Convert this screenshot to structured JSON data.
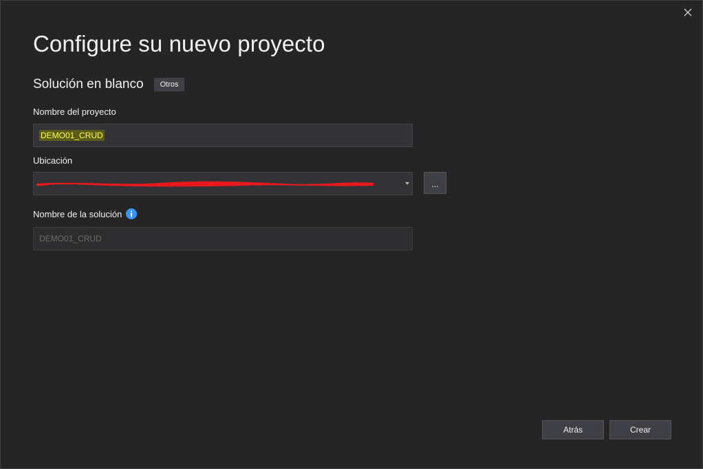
{
  "dialog": {
    "title": "Configure su nuevo proyecto",
    "template_name": "Solución en blanco",
    "template_tag": "Otros"
  },
  "project_name": {
    "label": "Nombre del proyecto",
    "value": "DEMO01_CRUD"
  },
  "location": {
    "label": "Ubicación",
    "value": "",
    "browse_label": "..."
  },
  "solution_name": {
    "label": "Nombre de la solución",
    "placeholder": "DEMO01_CRUD"
  },
  "buttons": {
    "back_label": "Atrás",
    "create_label": "Crear"
  },
  "icons": {
    "close": "close-icon",
    "info": "info-icon",
    "dropdown": "chevron-down-icon"
  },
  "colors": {
    "background": "#252526",
    "input_bg": "#333337",
    "button_bg": "#3f3f46",
    "highlight": "#ffff55",
    "info_blue": "#3794ff",
    "redaction": "#e8191d"
  }
}
